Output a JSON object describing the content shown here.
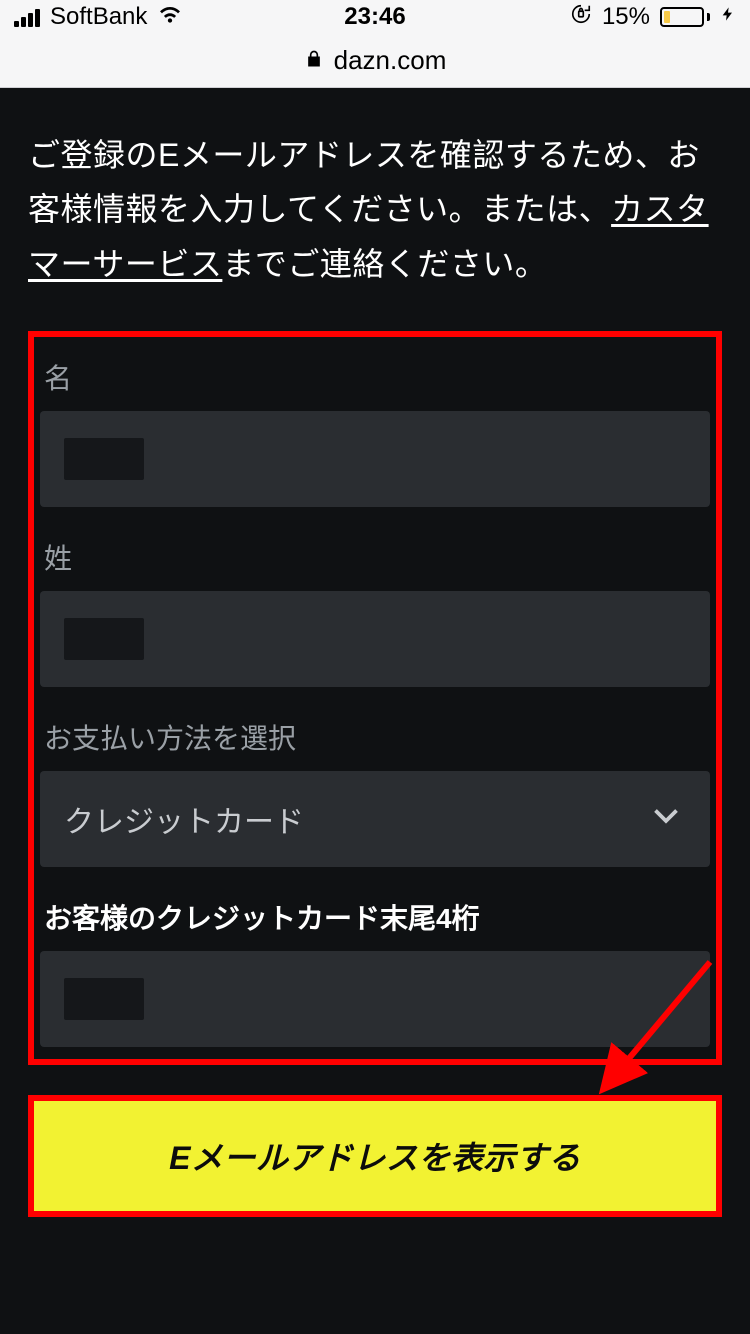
{
  "statusbar": {
    "carrier": "SoftBank",
    "time": "23:46",
    "battery_pct": "15%"
  },
  "addressbar": {
    "domain": "dazn.com"
  },
  "page": {
    "intro_pre": "ご登録のEメールアドレスを確認するため、お客様情報を入力してください。または、",
    "intro_link": "カスタマーサービス",
    "intro_post": "までご連絡ください。"
  },
  "form": {
    "first_name_label": "名",
    "last_name_label": "姓",
    "payment_label": "お支払い方法を選択",
    "payment_selected": "クレジットカード",
    "cc4_label": "お客様のクレジットカード末尾4桁",
    "submit_label": "Eメールアドレスを表示する"
  }
}
